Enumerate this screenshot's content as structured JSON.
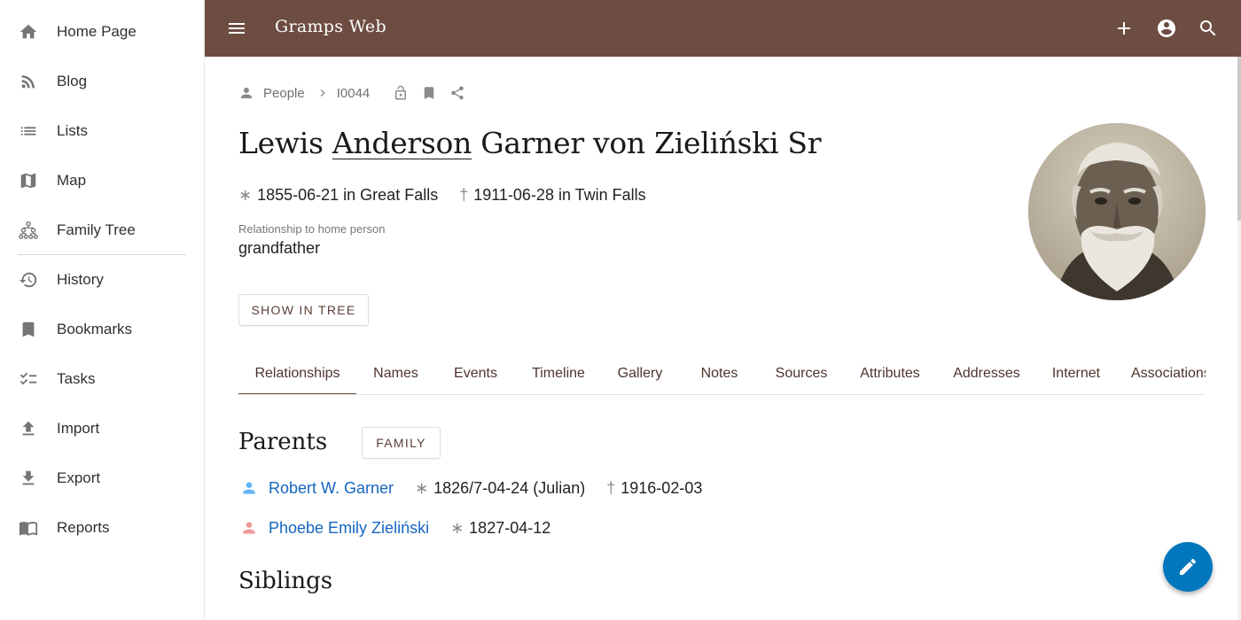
{
  "app": {
    "title": "Gramps Web"
  },
  "sidebar": {
    "items": [
      {
        "label": "Home Page",
        "icon": "home-icon"
      },
      {
        "label": "Blog",
        "icon": "rss-icon"
      },
      {
        "label": "Lists",
        "icon": "list-icon"
      },
      {
        "label": "Map",
        "icon": "map-icon"
      },
      {
        "label": "Family Tree",
        "icon": "family-tree-icon"
      },
      {
        "label": "History",
        "icon": "history-icon"
      },
      {
        "label": "Bookmarks",
        "icon": "bookmark-icon"
      },
      {
        "label": "Tasks",
        "icon": "tasks-icon"
      },
      {
        "label": "Import",
        "icon": "upload-icon"
      },
      {
        "label": "Export",
        "icon": "download-icon"
      },
      {
        "label": "Reports",
        "icon": "book-icon"
      }
    ]
  },
  "topbar": {
    "actions": [
      "add-icon",
      "account-icon",
      "search-icon"
    ]
  },
  "breadcrumb": {
    "section": "People",
    "id": "I0044"
  },
  "person": {
    "first_name": "Lewis",
    "surname": "Anderson",
    "rest_name": "Garner von Zieliński Sr",
    "birth_symbol": "∗",
    "birth": "1855-06-21 in Great Falls",
    "death_symbol": "†",
    "death": "1911-06-28 in Twin Falls",
    "relationship_caption": "Relationship to home person",
    "relationship": "grandfather",
    "show_in_tree_label": "SHOW IN TREE"
  },
  "tabs": [
    {
      "label": "Relationships",
      "active": true
    },
    {
      "label": "Names"
    },
    {
      "label": "Events"
    },
    {
      "label": "Timeline"
    },
    {
      "label": "Gallery"
    },
    {
      "label": "Notes"
    },
    {
      "label": "Sources"
    },
    {
      "label": "Attributes"
    },
    {
      "label": "Addresses"
    },
    {
      "label": "Internet"
    },
    {
      "label": "Associations"
    }
  ],
  "parents": {
    "title": "Parents",
    "family_button": "FAMILY",
    "people": [
      {
        "name": "Robert W. Garner",
        "gender_color": "#64b5f6",
        "birth": "1826/7-04-24 (Julian)",
        "death": "1916-02-03"
      },
      {
        "name": "Phoebe Emily Zieliński",
        "gender_color": "#ef9a9a",
        "birth": "1827-04-12"
      }
    ]
  },
  "siblings": {
    "title": "Siblings"
  },
  "colors": {
    "appbar": "#6d4c41",
    "link": "#1565c0",
    "fab": "#0277bd"
  }
}
